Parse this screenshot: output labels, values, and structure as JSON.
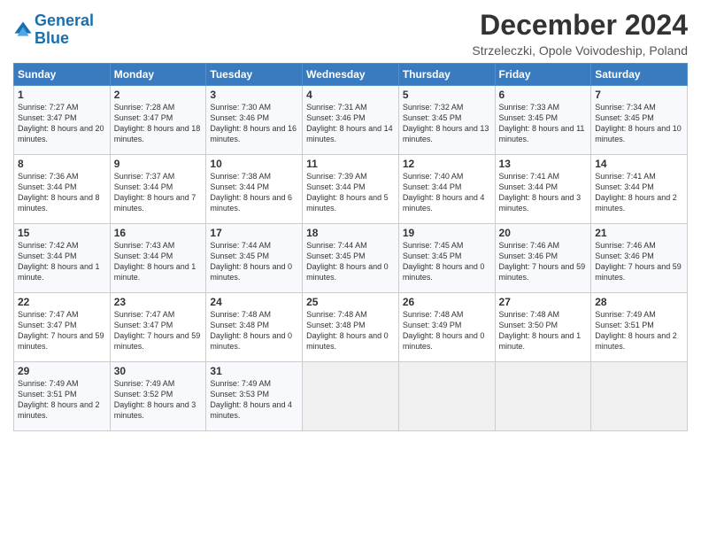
{
  "logo": {
    "line1": "General",
    "line2": "Blue"
  },
  "title": "December 2024",
  "location": "Strzeleczki, Opole Voivodeship, Poland",
  "headers": [
    "Sunday",
    "Monday",
    "Tuesday",
    "Wednesday",
    "Thursday",
    "Friday",
    "Saturday"
  ],
  "weeks": [
    [
      {
        "day": "1",
        "sunrise": "Sunrise: 7:27 AM",
        "sunset": "Sunset: 3:47 PM",
        "daylight": "Daylight: 8 hours and 20 minutes."
      },
      {
        "day": "2",
        "sunrise": "Sunrise: 7:28 AM",
        "sunset": "Sunset: 3:47 PM",
        "daylight": "Daylight: 8 hours and 18 minutes."
      },
      {
        "day": "3",
        "sunrise": "Sunrise: 7:30 AM",
        "sunset": "Sunset: 3:46 PM",
        "daylight": "Daylight: 8 hours and 16 minutes."
      },
      {
        "day": "4",
        "sunrise": "Sunrise: 7:31 AM",
        "sunset": "Sunset: 3:46 PM",
        "daylight": "Daylight: 8 hours and 14 minutes."
      },
      {
        "day": "5",
        "sunrise": "Sunrise: 7:32 AM",
        "sunset": "Sunset: 3:45 PM",
        "daylight": "Daylight: 8 hours and 13 minutes."
      },
      {
        "day": "6",
        "sunrise": "Sunrise: 7:33 AM",
        "sunset": "Sunset: 3:45 PM",
        "daylight": "Daylight: 8 hours and 11 minutes."
      },
      {
        "day": "7",
        "sunrise": "Sunrise: 7:34 AM",
        "sunset": "Sunset: 3:45 PM",
        "daylight": "Daylight: 8 hours and 10 minutes."
      }
    ],
    [
      {
        "day": "8",
        "sunrise": "Sunrise: 7:36 AM",
        "sunset": "Sunset: 3:44 PM",
        "daylight": "Daylight: 8 hours and 8 minutes."
      },
      {
        "day": "9",
        "sunrise": "Sunrise: 7:37 AM",
        "sunset": "Sunset: 3:44 PM",
        "daylight": "Daylight: 8 hours and 7 minutes."
      },
      {
        "day": "10",
        "sunrise": "Sunrise: 7:38 AM",
        "sunset": "Sunset: 3:44 PM",
        "daylight": "Daylight: 8 hours and 6 minutes."
      },
      {
        "day": "11",
        "sunrise": "Sunrise: 7:39 AM",
        "sunset": "Sunset: 3:44 PM",
        "daylight": "Daylight: 8 hours and 5 minutes."
      },
      {
        "day": "12",
        "sunrise": "Sunrise: 7:40 AM",
        "sunset": "Sunset: 3:44 PM",
        "daylight": "Daylight: 8 hours and 4 minutes."
      },
      {
        "day": "13",
        "sunrise": "Sunrise: 7:41 AM",
        "sunset": "Sunset: 3:44 PM",
        "daylight": "Daylight: 8 hours and 3 minutes."
      },
      {
        "day": "14",
        "sunrise": "Sunrise: 7:41 AM",
        "sunset": "Sunset: 3:44 PM",
        "daylight": "Daylight: 8 hours and 2 minutes."
      }
    ],
    [
      {
        "day": "15",
        "sunrise": "Sunrise: 7:42 AM",
        "sunset": "Sunset: 3:44 PM",
        "daylight": "Daylight: 8 hours and 1 minute."
      },
      {
        "day": "16",
        "sunrise": "Sunrise: 7:43 AM",
        "sunset": "Sunset: 3:44 PM",
        "daylight": "Daylight: 8 hours and 1 minute."
      },
      {
        "day": "17",
        "sunrise": "Sunrise: 7:44 AM",
        "sunset": "Sunset: 3:45 PM",
        "daylight": "Daylight: 8 hours and 0 minutes."
      },
      {
        "day": "18",
        "sunrise": "Sunrise: 7:44 AM",
        "sunset": "Sunset: 3:45 PM",
        "daylight": "Daylight: 8 hours and 0 minutes."
      },
      {
        "day": "19",
        "sunrise": "Sunrise: 7:45 AM",
        "sunset": "Sunset: 3:45 PM",
        "daylight": "Daylight: 8 hours and 0 minutes."
      },
      {
        "day": "20",
        "sunrise": "Sunrise: 7:46 AM",
        "sunset": "Sunset: 3:46 PM",
        "daylight": "Daylight: 7 hours and 59 minutes."
      },
      {
        "day": "21",
        "sunrise": "Sunrise: 7:46 AM",
        "sunset": "Sunset: 3:46 PM",
        "daylight": "Daylight: 7 hours and 59 minutes."
      }
    ],
    [
      {
        "day": "22",
        "sunrise": "Sunrise: 7:47 AM",
        "sunset": "Sunset: 3:47 PM",
        "daylight": "Daylight: 7 hours and 59 minutes."
      },
      {
        "day": "23",
        "sunrise": "Sunrise: 7:47 AM",
        "sunset": "Sunset: 3:47 PM",
        "daylight": "Daylight: 7 hours and 59 minutes."
      },
      {
        "day": "24",
        "sunrise": "Sunrise: 7:48 AM",
        "sunset": "Sunset: 3:48 PM",
        "daylight": "Daylight: 8 hours and 0 minutes."
      },
      {
        "day": "25",
        "sunrise": "Sunrise: 7:48 AM",
        "sunset": "Sunset: 3:48 PM",
        "daylight": "Daylight: 8 hours and 0 minutes."
      },
      {
        "day": "26",
        "sunrise": "Sunrise: 7:48 AM",
        "sunset": "Sunset: 3:49 PM",
        "daylight": "Daylight: 8 hours and 0 minutes."
      },
      {
        "day": "27",
        "sunrise": "Sunrise: 7:48 AM",
        "sunset": "Sunset: 3:50 PM",
        "daylight": "Daylight: 8 hours and 1 minute."
      },
      {
        "day": "28",
        "sunrise": "Sunrise: 7:49 AM",
        "sunset": "Sunset: 3:51 PM",
        "daylight": "Daylight: 8 hours and 2 minutes."
      }
    ],
    [
      {
        "day": "29",
        "sunrise": "Sunrise: 7:49 AM",
        "sunset": "Sunset: 3:51 PM",
        "daylight": "Daylight: 8 hours and 2 minutes."
      },
      {
        "day": "30",
        "sunrise": "Sunrise: 7:49 AM",
        "sunset": "Sunset: 3:52 PM",
        "daylight": "Daylight: 8 hours and 3 minutes."
      },
      {
        "day": "31",
        "sunrise": "Sunrise: 7:49 AM",
        "sunset": "Sunset: 3:53 PM",
        "daylight": "Daylight: 8 hours and 4 minutes."
      },
      null,
      null,
      null,
      null
    ]
  ]
}
